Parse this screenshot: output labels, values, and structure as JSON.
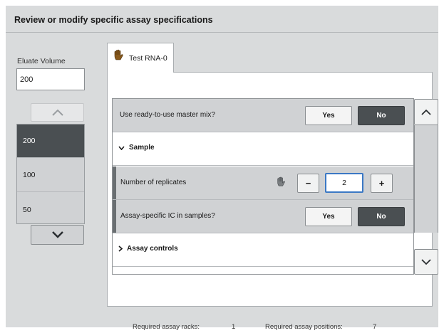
{
  "header": {
    "title": "Review or modify specific assay specifications"
  },
  "eluate": {
    "label": "Eluate Volume",
    "value": "200",
    "options": [
      "200",
      "100",
      "50"
    ],
    "selected": "200"
  },
  "tab": {
    "label": "Test RNA-0",
    "icon": "hand-icon"
  },
  "rows": {
    "master_mix": {
      "label": "Use ready-to-use master mix?",
      "yes": "Yes",
      "no": "No",
      "selected": "No"
    },
    "sample_section": {
      "label": "Sample",
      "expanded": true
    },
    "replicates": {
      "label": "Number of replicates",
      "minus": "−",
      "value": "2",
      "plus": "+"
    },
    "ic": {
      "label": "Assay-specific IC in samples?",
      "yes": "Yes",
      "no": "No",
      "selected": "No"
    },
    "controls_section": {
      "label": "Assay controls",
      "expanded": false
    }
  },
  "footer": {
    "racks_label": "Required assay racks:",
    "racks_value": "1",
    "positions_label": "Required assay positions:",
    "positions_value": "7"
  },
  "colors": {
    "selected_dark": "#4a4f52",
    "focus_blue": "#3b78c4",
    "panel_grey": "#d9dbdc"
  }
}
